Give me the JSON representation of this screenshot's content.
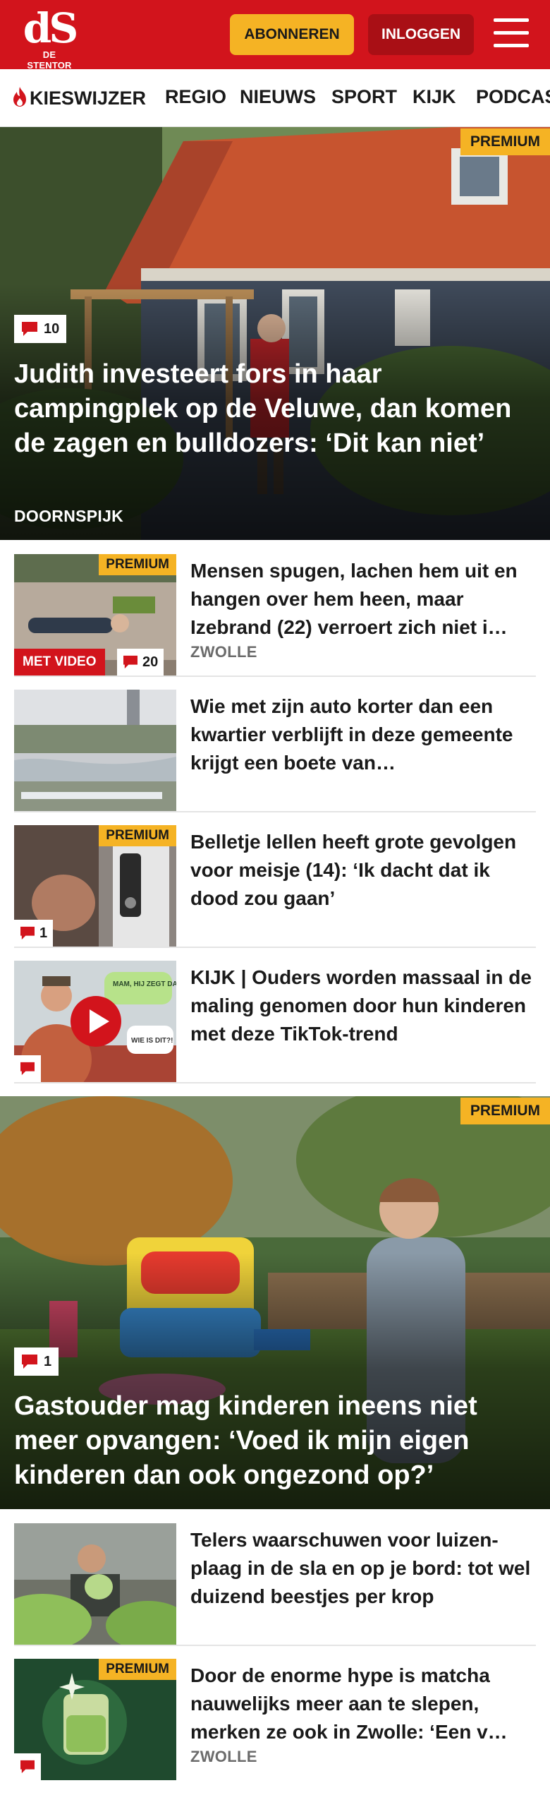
{
  "brand": {
    "logo_mark": "dS",
    "logo_text": "DE STENTOR"
  },
  "header": {
    "subscribe_label": "ABONNEREN",
    "login_label": "INLOGGEN",
    "menu_icon": "hamburger-icon"
  },
  "nav": {
    "items": [
      {
        "label": "KIESWIJZER",
        "icon": "flame-icon"
      },
      {
        "label": "REGIO"
      },
      {
        "label": "NIEUWS"
      },
      {
        "label": "SPORT"
      },
      {
        "label": "KIJK"
      },
      {
        "label": "PODCAS"
      }
    ]
  },
  "colors": {
    "brand_red": "#d2141c",
    "dark_red": "#a90f15",
    "premium_yellow": "#f5b324"
  },
  "articles": [
    {
      "type": "hero",
      "premium": "PREMIUM",
      "comments": "10",
      "title": "Judith investeert fors in haar campingplek op de Veluwe, dan komen de zagen en bulldozers: ‘Dit kan niet’",
      "location": "DOORNSPIJK"
    },
    {
      "type": "list",
      "premium": "PREMIUM",
      "video": "MET VIDEO",
      "comments": "20",
      "title": "Mensen spugen, lachen hem uit en hangen over hem heen, maar Izebrand (22) verroert zich niet i…",
      "location": "ZWOLLE"
    },
    {
      "type": "list",
      "title": "Wie met zijn auto korter dan een kwartier verblijft in deze gemeente krijgt een boete van…"
    },
    {
      "type": "list",
      "premium": "PREMIUM",
      "comments": "1",
      "title": "Belletje lellen heeft grote gevolgen voor meisje (14): ‘Ik dacht dat ik dood zou gaan’"
    },
    {
      "type": "list",
      "title": "KIJK | Ouders worden massaal in de maling genomen door hun kinderen met deze TikTok-trend",
      "thumb_text_1": "MAM, HIJ ZEGT DAT HIJ JE KENT?",
      "thumb_text_2": "WIE IS DIT?!"
    },
    {
      "type": "hero",
      "premium": "PREMIUM",
      "comments": "1",
      "title": "Gastouder mag kinderen ineens niet meer opvangen: ‘Voed ik mijn eigen kinderen dan ook ongezond op?’"
    },
    {
      "type": "list",
      "title": "Telers waarschuwen voor luizen­plaag in de sla en op je bord: tot wel duizend beestjes per krop"
    },
    {
      "type": "list",
      "premium": "PREMIUM",
      "title": "Door de enorme hype is matcha nauwelijks meer aan te slepen, merken ze ook in Zwolle: ‘Een v…",
      "location": "ZWOLLE"
    }
  ]
}
